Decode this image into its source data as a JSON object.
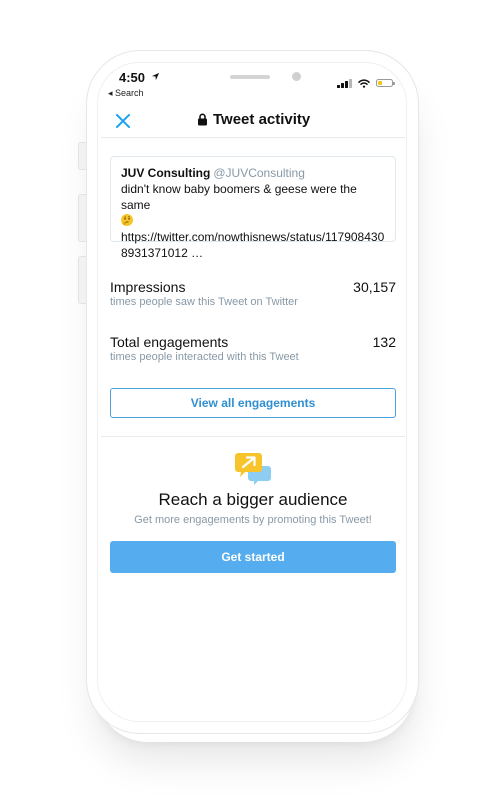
{
  "status_bar": {
    "time": "4:50",
    "back_label": "◂ Search",
    "location_icon": "location-arrow-icon",
    "signal_icon": "signal-bars-icon",
    "wifi_icon": "wifi-icon",
    "battery_icon": "battery-low-icon",
    "battery_color": "#f5c518"
  },
  "header": {
    "close_icon": "close-icon",
    "lock_icon": "lock-icon",
    "title": "Tweet activity"
  },
  "tweet": {
    "author_name": "JUV Consulting",
    "author_handle": "@JUVConsulting",
    "text": "didn't know baby boomers & geese were the same",
    "emoji_icon": "thinking-face-emoji",
    "link_line1": "https://twitter.com/nowthisnews/status/117908430",
    "link_line2": "8931371012 …"
  },
  "metrics": [
    {
      "label": "Impressions",
      "sublabel": "times people saw this Tweet on Twitter",
      "value": "30,157"
    },
    {
      "label": "Total engagements",
      "sublabel": "times people interacted with this Tweet",
      "value": "132"
    }
  ],
  "view_all_button": {
    "label": "View all engagements"
  },
  "promo": {
    "icon": "promote-arrow-chat-icon",
    "title": "Reach a bigger audience",
    "subtitle": "Get more engagements by promoting this Tweet!",
    "button_label": "Get started"
  },
  "colors": {
    "accent": "#55acee",
    "link_blue": "#2f8fd0",
    "muted_text": "#8899a6",
    "promo_yellow": "#f7c52b",
    "promo_blue": "#8ecdf2"
  }
}
